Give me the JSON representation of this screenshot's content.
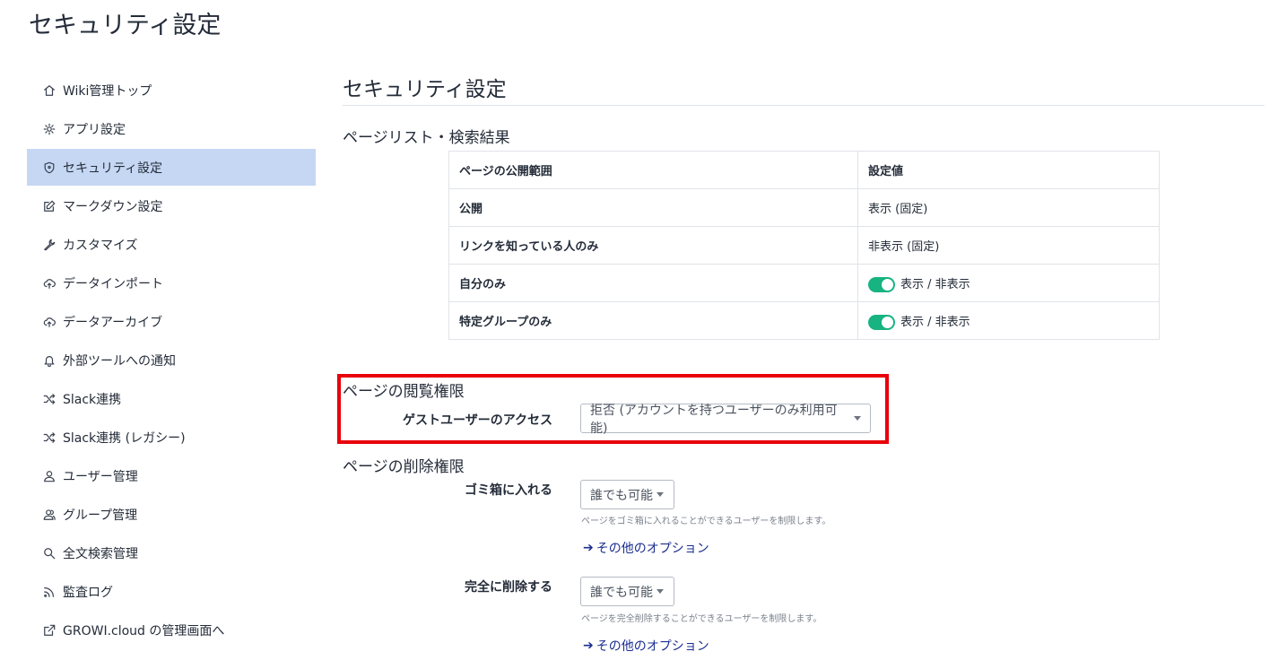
{
  "page_title": "セキュリティ設定",
  "sidebar": {
    "items": [
      {
        "label": "Wiki管理トップ",
        "icon": "home-icon",
        "active": false
      },
      {
        "label": "アプリ設定",
        "icon": "gear-icon",
        "active": false
      },
      {
        "label": "セキュリティ設定",
        "icon": "shield-icon",
        "active": true
      },
      {
        "label": "マークダウン設定",
        "icon": "edit-icon",
        "active": false
      },
      {
        "label": "カスタマイズ",
        "icon": "wrench-icon",
        "active": false
      },
      {
        "label": "データインポート",
        "icon": "cloud-upload-icon",
        "active": false
      },
      {
        "label": "データアーカイブ",
        "icon": "cloud-upload-icon",
        "active": false
      },
      {
        "label": "外部ツールへの通知",
        "icon": "bell-icon",
        "active": false
      },
      {
        "label": "Slack連携",
        "icon": "shuffle-icon",
        "active": false
      },
      {
        "label": "Slack連携 (レガシー)",
        "icon": "shuffle-icon",
        "active": false
      },
      {
        "label": "ユーザー管理",
        "icon": "user-icon",
        "active": false
      },
      {
        "label": "グループ管理",
        "icon": "users-icon",
        "active": false
      },
      {
        "label": "全文検索管理",
        "icon": "search-icon",
        "active": false
      },
      {
        "label": "監査ログ",
        "icon": "rss-icon",
        "active": false
      },
      {
        "label": "GROWI.cloud の管理画面へ",
        "icon": "external-link-icon",
        "active": false
      }
    ]
  },
  "main": {
    "heading": "セキュリティ設定",
    "page_list": {
      "title": "ページリスト・検索結果",
      "headers": [
        "ページの公開範囲",
        "設定値"
      ],
      "rows": [
        {
          "scope": "公開",
          "value": "表示 (固定)",
          "toggle": false
        },
        {
          "scope": "リンクを知っている人のみ",
          "value": "非表示 (固定)",
          "toggle": false
        },
        {
          "scope": "自分のみ",
          "value": "表示 / 非表示",
          "toggle": true
        },
        {
          "scope": "特定グループのみ",
          "value": "表示 / 非表示",
          "toggle": true
        }
      ]
    },
    "view_permission": {
      "title": "ページの閲覧権限",
      "guest_access_label": "ゲストユーザーのアクセス",
      "guest_access_value": "拒否 (アカウントを持つユーザーのみ利用可能)"
    },
    "delete_permission": {
      "title": "ページの削除権限",
      "trash_label": "ゴミ箱に入れる",
      "trash_value": "誰でも可能",
      "trash_hint": "ページをゴミ箱に入れることができるユーザーを制限します。",
      "trash_more": "その他のオプション",
      "complete_label": "完全に削除する",
      "complete_value": "誰でも可能",
      "complete_hint": "ページを完全削除することができるユーザーを制限します。",
      "complete_more": "その他のオプション"
    }
  },
  "colors": {
    "active_bg": "#c5d7f3",
    "toggle_on": "#17b381",
    "highlight_box": "#e8000b",
    "link": "#1b2e8f"
  }
}
